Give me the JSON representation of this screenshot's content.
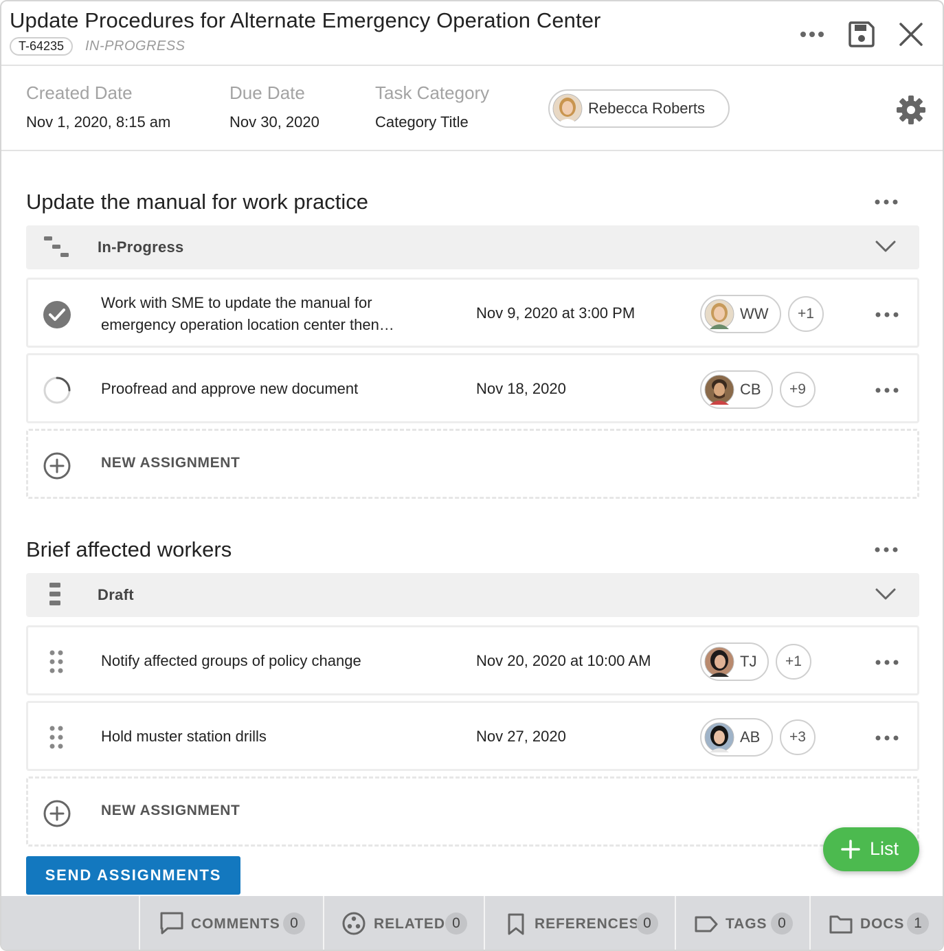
{
  "header": {
    "title": "Update Procedures for Alternate Emergency Operation Center",
    "task_id": "T-64235",
    "status": "IN-PROGRESS",
    "icons": [
      "more-icon",
      "save-icon",
      "close-icon"
    ]
  },
  "meta": {
    "created_label": "Created Date",
    "created_value": "Nov 1, 2020, 8:15 am",
    "due_label": "Due Date",
    "due_value": "Nov 30, 2020",
    "category_label": "Task Category",
    "category_value": "Category Title",
    "owner": "Rebecca Roberts"
  },
  "sections": [
    {
      "title": "Update the manual for work practice",
      "status": "In-Progress",
      "rows": [
        {
          "text": "Work with SME to update the manual for emergency operation location center then…",
          "date": "Nov 9, 2020 at 3:00 PM",
          "initials": "WW",
          "extra": "+1",
          "state": "complete"
        },
        {
          "text": "Proofread and approve new document",
          "date": "Nov 18, 2020",
          "initials": "CB",
          "extra": "+9",
          "state": "in-progress"
        }
      ],
      "new_label": "NEW ASSIGNMENT"
    },
    {
      "title": "Brief affected workers",
      "status": "Draft",
      "rows": [
        {
          "text": "Notify affected groups of policy change",
          "date": "Nov 20, 2020 at 10:00 AM",
          "initials": "TJ",
          "extra": "+1",
          "state": "draft"
        },
        {
          "text": "Hold muster station drills",
          "date": "Nov 27, 2020",
          "initials": "AB",
          "extra": "+3",
          "state": "draft"
        }
      ],
      "new_label": "NEW ASSIGNMENT"
    }
  ],
  "send_button": "SEND ASSIGNMENTS",
  "fab_label": "List",
  "footer_tabs": [
    {
      "label": "COMMENTS",
      "count": "0",
      "icon": "comment-icon"
    },
    {
      "label": "RELATED",
      "count": "0",
      "icon": "related-icon"
    },
    {
      "label": "REFERENCES",
      "count": "0",
      "icon": "bookmark-icon"
    },
    {
      "label": "TAGS",
      "count": "0",
      "icon": "tag-icon"
    },
    {
      "label": "DOCS",
      "count": "1",
      "icon": "folder-icon"
    }
  ],
  "colors": {
    "primary_button": "#1378bf",
    "fab": "#4cba4f",
    "footer_bg": "#d9dadd",
    "status_bar_bg": "#f0f0f0"
  }
}
